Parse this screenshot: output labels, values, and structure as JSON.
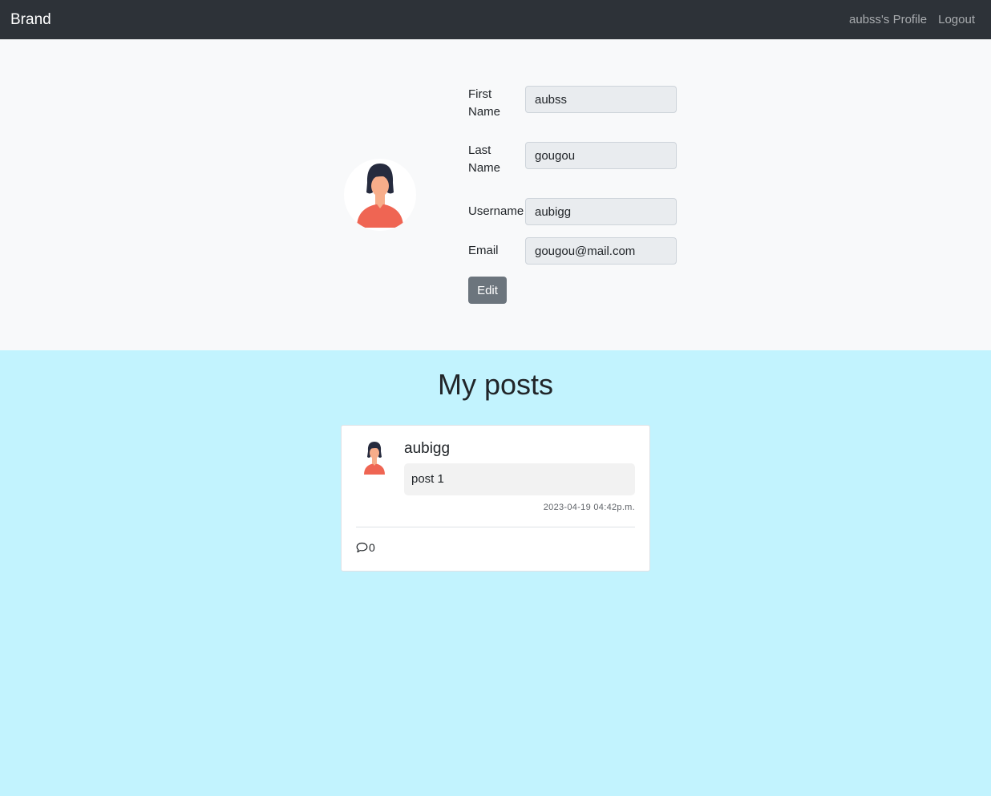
{
  "navbar": {
    "brand": "Brand",
    "profile_link": "aubss's Profile",
    "logout_link": "Logout"
  },
  "profile": {
    "fields": {
      "first_name": {
        "label": "First Name",
        "value": "aubss"
      },
      "last_name": {
        "label": "Last Name",
        "value": "gougou"
      },
      "username": {
        "label": "Username",
        "value": "aubigg"
      },
      "email": {
        "label": "Email",
        "value": "gougou@mail.com"
      }
    },
    "edit_label": "Edit"
  },
  "posts": {
    "title": "My posts",
    "items": [
      {
        "author": "aubigg",
        "content": "post 1",
        "timestamp": "2023-04-19 04:42p.m.",
        "comment_count": "0"
      }
    ]
  },
  "icons": {
    "avatar": "user-avatar-icon",
    "comment": "comment-bubble-icon"
  },
  "colors": {
    "navbar_bg": "#2d3238",
    "profile_bg": "#f8f9fa",
    "posts_bg": "#c2f3fe",
    "edit_button": "#6c757d",
    "avatar_shirt": "#ef6553",
    "avatar_hair": "#262b3e",
    "avatar_skin": "#f7ad8a"
  }
}
